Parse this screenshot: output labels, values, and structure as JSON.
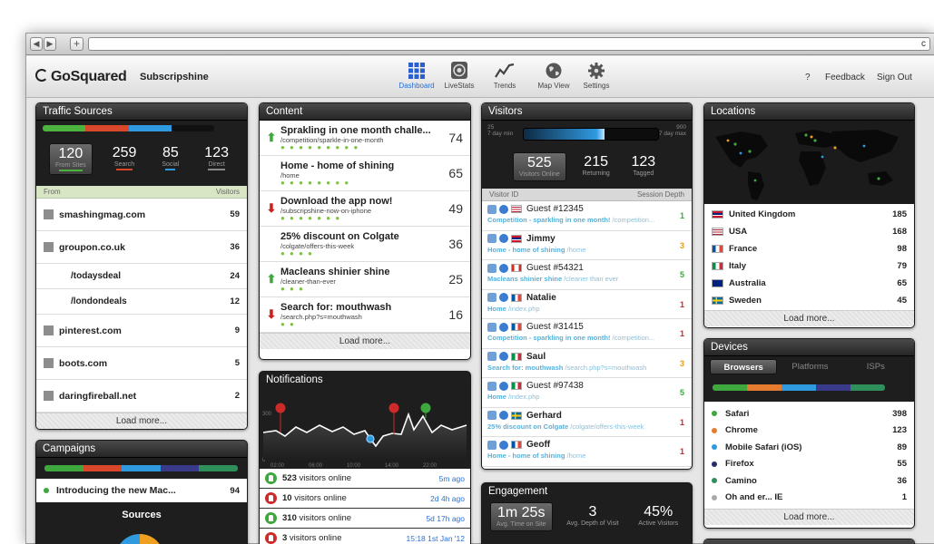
{
  "browser": {
    "back": "◀",
    "forward": "▶",
    "new_tab": "+",
    "reload": "c"
  },
  "app": {
    "brand": "GoSquared",
    "site": "Subscripshine"
  },
  "nav": [
    {
      "label": "Dashboard",
      "icon": "grid-icon",
      "active": true
    },
    {
      "label": "LiveStats",
      "icon": "livestats-icon"
    },
    {
      "label": "Trends",
      "icon": "trends-icon"
    },
    {
      "label": "Map View",
      "icon": "globe-icon"
    },
    {
      "label": "Settings",
      "icon": "gear-icon"
    }
  ],
  "top_right": {
    "help": "?",
    "feedback": "Feedback",
    "signout": "Sign Out"
  },
  "traffic": {
    "title": "Traffic Sources",
    "bar_colors": [
      "#4cb33f",
      "#d9472b",
      "#2f9ae0",
      "#111111"
    ],
    "stats": [
      {
        "value": "120",
        "label": "From Sites",
        "color": "#4cb33f"
      },
      {
        "value": "259",
        "label": "Search",
        "color": "#d9472b"
      },
      {
        "value": "85",
        "label": "Social",
        "color": "#2f9ae0"
      },
      {
        "value": "123",
        "label": "Direct",
        "color": "#888888"
      }
    ],
    "col_from": "From",
    "col_visitors": "Visitors",
    "rows": [
      {
        "name": "smashingmag.com",
        "value": "59"
      },
      {
        "name": "groupon.co.uk",
        "value": "36"
      },
      {
        "name": "/todaysdeal",
        "value": "24",
        "sub": true
      },
      {
        "name": "/londondeals",
        "value": "12",
        "sub": true
      },
      {
        "name": "pinterest.com",
        "value": "9"
      },
      {
        "name": "boots.com",
        "value": "5"
      },
      {
        "name": "daringfireball.net",
        "value": "2"
      }
    ],
    "load_more": "Load more..."
  },
  "campaigns": {
    "title": "Campaigns",
    "bar_colors": [
      "#3ea83e",
      "#d9472b",
      "#2f9ae0",
      "#3a3a8a",
      "#2f8f5a"
    ],
    "item": "Introducing the new Mac...",
    "item_value": "94",
    "sources": "Sources"
  },
  "content": {
    "title": "Content",
    "rows": [
      {
        "title": "Sprakling in one month challe...",
        "url": "/competition/sparkle-in-one-month",
        "value": "74",
        "trend": "up",
        "dots": "● ● ● ● ● ● ● ● ●"
      },
      {
        "title": "Home - home of shining",
        "url": "/home",
        "value": "65",
        "trend": "",
        "dots": "● ● ● ● ● ● ● ●"
      },
      {
        "title": "Download the app now!",
        "url": "/subscripshine-now-on-iphone",
        "value": "49",
        "trend": "down",
        "dots": "● ● ● ● ● ● ●"
      },
      {
        "title": "25% discount on Colgate",
        "url": "/colgate/offers-this-week",
        "value": "36",
        "trend": "",
        "dots": "● ● ● ●"
      },
      {
        "title": "Macleans shinier shine",
        "url": "/cleaner-than-ever",
        "value": "25",
        "trend": "up",
        "dots": "● ● ●"
      },
      {
        "title": "Search for: mouthwash",
        "url": "/search.php?s=mouthwash",
        "value": "16",
        "trend": "down",
        "dots": "● ●"
      }
    ],
    "load_more": "Load more..."
  },
  "notifications": {
    "title": "Notifications",
    "y_label": "300",
    "y_min": "0",
    "times": [
      "02:00",
      "06:00",
      "10:00",
      "14:00",
      "22:00"
    ],
    "rows": [
      {
        "type": "up",
        "count": "523",
        "text": " visitors online",
        "time": "5m ago"
      },
      {
        "type": "down",
        "count": "10",
        "text": " visitors online",
        "time": "2d 4h ago"
      },
      {
        "type": "up",
        "count": "310",
        "text": " visitors online",
        "time": "5d 17h ago"
      },
      {
        "type": "down",
        "count": "3",
        "text": " visitors online",
        "time": "15:18 1st Jan '12"
      }
    ]
  },
  "visitors": {
    "title": "Visitors",
    "gauge_min": "25",
    "gauge_min_label": "7 day min",
    "gauge_max": "900",
    "gauge_max_label": "7 day max",
    "gauge_level": 0.6,
    "stats": [
      {
        "value": "525",
        "label": "Visitors Online"
      },
      {
        "value": "215",
        "label": "Returning"
      },
      {
        "value": "123",
        "label": "Tagged"
      }
    ],
    "col_id": "Visitor ID",
    "col_depth": "Session Depth",
    "rows": [
      {
        "name": "Guest #12345",
        "bold": false,
        "page": "Competition - sparkling in one month!",
        "path": "/competition...",
        "depth": "1",
        "depth_color": "#3ea83e",
        "flag": "us"
      },
      {
        "name": "Jimmy",
        "bold": true,
        "page": "Home - home of shining",
        "path": "/home",
        "depth": "3",
        "depth_color": "#e89a1a",
        "flag": "uk"
      },
      {
        "name": "Guest #54321",
        "bold": false,
        "page": "Macleans shinier shine",
        "path": "/cleaner than ever",
        "depth": "5",
        "depth_color": "#3ea83e",
        "flag": "ca"
      },
      {
        "name": "Natalie",
        "bold": true,
        "page": "Home",
        "path": "/index.php",
        "depth": "1",
        "depth_color": "#cf2a2a",
        "flag": "fr"
      },
      {
        "name": "Guest #31415",
        "bold": false,
        "page": "Competition - sparkling in one month!",
        "path": "/competition...",
        "depth": "1",
        "depth_color": "#cf2a2a",
        "flag": "fr"
      },
      {
        "name": "Saul",
        "bold": true,
        "page": "Search for: mouthwash",
        "path": "/search.php?s=mouthwash",
        "depth": "3",
        "depth_color": "#e89a1a",
        "flag": "it"
      },
      {
        "name": "Guest #97438",
        "bold": false,
        "page": "Home",
        "path": "/index.php",
        "depth": "5",
        "depth_color": "#3ea83e",
        "flag": "it"
      },
      {
        "name": "Gerhard",
        "bold": true,
        "page": "25% discount on Colgate",
        "path": "/colgate/offers-this-week",
        "depth": "1",
        "depth_color": "#cf2a2a",
        "flag": "se"
      },
      {
        "name": "Geoff",
        "bold": true,
        "page": "Home - home of shining",
        "path": "/home",
        "depth": "1",
        "depth_color": "#cf2a2a",
        "flag": "fr"
      }
    ]
  },
  "engagement": {
    "title": "Engagement",
    "time": "1m 25s",
    "time_label": "Avg. Time on Site",
    "depth": "3",
    "depth_label": "Avg. Depth of Visit",
    "active": "45%",
    "active_label": "Active Visitors"
  },
  "locations": {
    "title": "Locations",
    "rows": [
      {
        "name": "United Kingdom",
        "value": "185",
        "flag": "uk"
      },
      {
        "name": "USA",
        "value": "168",
        "flag": "us"
      },
      {
        "name": "France",
        "value": "98",
        "flag": "fr"
      },
      {
        "name": "Italy",
        "value": "79",
        "flag": "it"
      },
      {
        "name": "Australia",
        "value": "65",
        "flag": "au"
      },
      {
        "name": "Sweden",
        "value": "45",
        "flag": "se"
      }
    ],
    "load_more": "Load more..."
  },
  "devices": {
    "title": "Devices",
    "tabs": [
      "Browsers",
      "Platforms",
      "ISPs"
    ],
    "bar_colors": [
      "#3ea83e",
      "#e57b2e",
      "#2f9ae0",
      "#3a3a8a",
      "#2f8f5a"
    ],
    "rows": [
      {
        "name": "Safari",
        "value": "398",
        "color": "#3ea83e"
      },
      {
        "name": "Chrome",
        "value": "123",
        "color": "#e57b2e"
      },
      {
        "name": "Mobile Safari (iOS)",
        "value": "89",
        "color": "#2f9ae0"
      },
      {
        "name": "Firefox",
        "value": "55",
        "color": "#2a2a6a"
      },
      {
        "name": "Camino",
        "value": "36",
        "color": "#2f8f5a"
      },
      {
        "name": "Oh and er... IE",
        "value": "1",
        "color": "#aaaaaa"
      }
    ],
    "load_more": "Load more..."
  }
}
